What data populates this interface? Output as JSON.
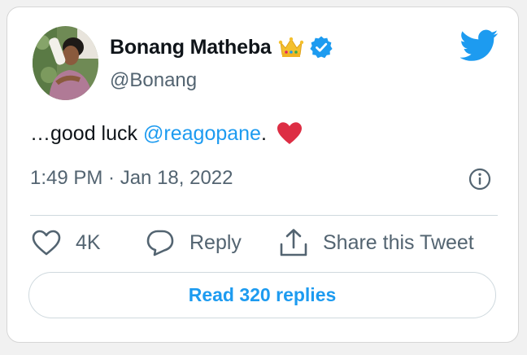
{
  "author": {
    "display_name": "Bonang Matheba",
    "handle": "@Bonang",
    "name_emoji": "crown-emoji",
    "verified_badge": "verified-icon"
  },
  "tweet": {
    "text_prefix": "…good luck",
    "mention": "@reagopane",
    "text_suffix": ".",
    "trailing_emoji": "red-heart-emoji",
    "timestamp": "1:49 PM · Jan 18, 2022"
  },
  "actions": {
    "like_count": "4K",
    "reply_label": "Reply",
    "share_label": "Share this Tweet"
  },
  "read_replies_label": "Read 320 replies",
  "colors": {
    "accent": "#1d9bf0",
    "text": "#0f1419",
    "secondary_text": "#536471",
    "heart": "#e0245e"
  }
}
